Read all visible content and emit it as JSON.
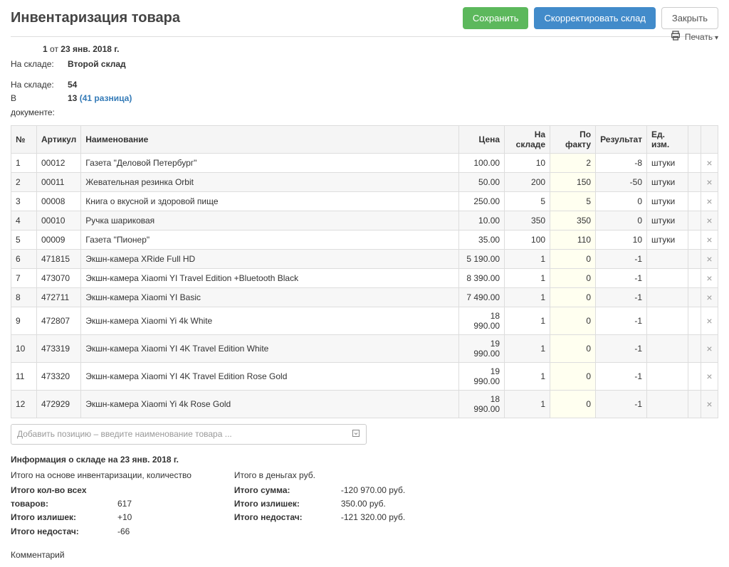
{
  "header": {
    "title": "Инвентаризация товара",
    "save": "Сохранить",
    "adjust": "Скорректировать склад",
    "close": "Закрыть"
  },
  "subhead": {
    "no": "1",
    "from": "от",
    "date": "23 янв. 2018 г.",
    "print": "Печать"
  },
  "meta": {
    "warehouse_label": "На складе:",
    "warehouse_value": "Второй склад",
    "stock_label": "На складе:",
    "stock_value": "54",
    "doc_label": "В документе:",
    "doc_value": "13",
    "diff": "(41 разница)"
  },
  "columns": {
    "no": "№",
    "art": "Артикул",
    "name": "Наименование",
    "price": "Цена",
    "stock": "На складе",
    "fact": "По факту",
    "result": "Результат",
    "unit": "Ед. изм."
  },
  "rows": [
    {
      "no": "1",
      "art": "00012",
      "name": "Газета \"Деловой Петербург\"",
      "price": "100.00",
      "stock": "10",
      "fact": "2",
      "result": "-8",
      "unit": "штуки"
    },
    {
      "no": "2",
      "art": "00011",
      "name": "Жевательная резинка Orbit",
      "price": "50.00",
      "stock": "200",
      "fact": "150",
      "result": "-50",
      "unit": "штуки"
    },
    {
      "no": "3",
      "art": "00008",
      "name": "Книга о вкусной и здоровой пище",
      "price": "250.00",
      "stock": "5",
      "fact": "5",
      "result": "0",
      "unit": "штуки"
    },
    {
      "no": "4",
      "art": "00010",
      "name": "Ручка шариковая",
      "price": "10.00",
      "stock": "350",
      "fact": "350",
      "result": "0",
      "unit": "штуки"
    },
    {
      "no": "5",
      "art": "00009",
      "name": "Газета \"Пионер\"",
      "price": "35.00",
      "stock": "100",
      "fact": "110",
      "result": "10",
      "unit": "штуки"
    },
    {
      "no": "6",
      "art": "471815",
      "name": "Экшн-камера XRide Full HD",
      "price": "5 190.00",
      "stock": "1",
      "fact": "0",
      "result": "-1",
      "unit": ""
    },
    {
      "no": "7",
      "art": "473070",
      "name": "Экшн-камера Xiaomi YI Travel Edition +Bluetooth Black",
      "price": "8 390.00",
      "stock": "1",
      "fact": "0",
      "result": "-1",
      "unit": ""
    },
    {
      "no": "8",
      "art": "472711",
      "name": "Экшн-камера Xiaomi YI Basic",
      "price": "7 490.00",
      "stock": "1",
      "fact": "0",
      "result": "-1",
      "unit": ""
    },
    {
      "no": "9",
      "art": "472807",
      "name": "Экшн-камера Xiaomi Yi 4k White",
      "price": "18 990.00",
      "stock": "1",
      "fact": "0",
      "result": "-1",
      "unit": ""
    },
    {
      "no": "10",
      "art": "473319",
      "name": "Экшн-камера Xiaomi YI 4K Travel Edition White",
      "price": "19 990.00",
      "stock": "1",
      "fact": "0",
      "result": "-1",
      "unit": ""
    },
    {
      "no": "11",
      "art": "473320",
      "name": "Экшн-камера Xiaomi YI 4K Travel Edition Rose Gold",
      "price": "19 990.00",
      "stock": "1",
      "fact": "0",
      "result": "-1",
      "unit": ""
    },
    {
      "no": "12",
      "art": "472929",
      "name": "Экшн-камера Xiaomi Yi 4k Rose Gold",
      "price": "18 990.00",
      "stock": "1",
      "fact": "0",
      "result": "-1",
      "unit": ""
    }
  ],
  "add_placeholder": "Добавить позицию – введите наименование товара ...",
  "summary": {
    "title": "Информация о складе на 23 янв. 2018 г.",
    "qty_caption": "Итого на основе инвентаризации, количество",
    "qty_total_l": "Итого кол-во всех товаров:",
    "qty_total_v": "617",
    "qty_plus_l": "Итого излишек:",
    "qty_plus_v": "+10",
    "qty_minus_l": "Итого недостач:",
    "qty_minus_v": "-66",
    "money_caption": "Итого в деньгах руб.",
    "money_total_l": "Итого сумма:",
    "money_total_v": "-120 970.00 руб.",
    "money_plus_l": "Итого излишек:",
    "money_plus_v": "350.00 руб.",
    "money_minus_l": "Итого недостач:",
    "money_minus_v": "-121 320.00 руб."
  },
  "comment_label": "Комментарий"
}
